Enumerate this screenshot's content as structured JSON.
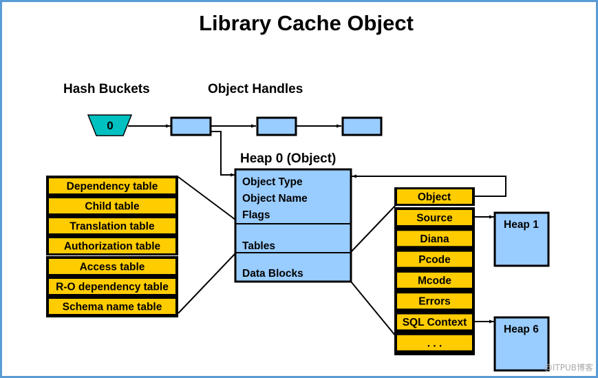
{
  "title": "Library Cache Object",
  "labels": {
    "hash_buckets": "Hash Buckets",
    "object_handles": "Object Handles",
    "heap0": "Heap 0 (Object)"
  },
  "hash_bucket": {
    "value": "0",
    "color": "#00c0c0"
  },
  "colors": {
    "handle_fill": "#99ccff",
    "table_fill": "#ffcc00",
    "border": "#000000",
    "frame": "#5b9bd5"
  },
  "heap0": {
    "section1": [
      "Object Type",
      "Object Name",
      "Flags"
    ],
    "section2": "Tables",
    "section3": "Data Blocks"
  },
  "tables_group1": [
    "Dependency table",
    "Child table",
    "Translation table",
    "Authorization table"
  ],
  "tables_group2": [
    "Access table",
    "R-O dependency table",
    "Schema name table"
  ],
  "data_blocks": {
    "object": "Object",
    "items": [
      "Source",
      "Diana",
      "Pcode",
      "Mcode",
      "Errors",
      "SQL Context",
      ". . ."
    ]
  },
  "heaps": {
    "heap1": "Heap 1",
    "heap6": "Heap 6"
  },
  "watermark": "@ITPUB博客"
}
